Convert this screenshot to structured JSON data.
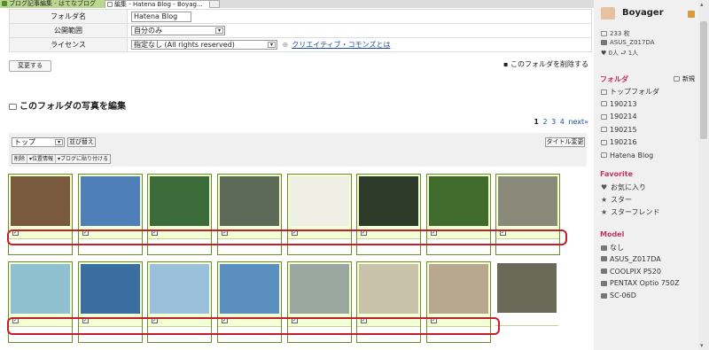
{
  "tabs": [
    {
      "label": "ブログ記事編集 - はてなブログ"
    },
    {
      "label": "編集 - Hatena Blog - Boyag...",
      "close": "×"
    }
  ],
  "form": {
    "rows": [
      {
        "label": "フォルダ名",
        "value": "Hatena Blog"
      },
      {
        "label": "公開範囲",
        "value": "自分のみ"
      },
      {
        "label": "ライセンス",
        "value": "指定なし (All rights reserved)",
        "link": "クリエイティブ・コモンズとは",
        "link_prefix": "⊕"
      }
    ],
    "change_button": "変更する",
    "delete_folder": "このフォルダを削除する"
  },
  "section": {
    "title": "このフォルダの写真を編集"
  },
  "pager": {
    "current": "1",
    "pages": [
      "2",
      "3",
      "4"
    ],
    "next": "next»"
  },
  "toolbar": {
    "sort_select": "トップ",
    "sort_button": "並び替え",
    "title_button": "タイトル変更",
    "actions": [
      "削除",
      "▾位置情報",
      "▾ブログに貼り付ける"
    ]
  },
  "photos": {
    "checkmark": "✓",
    "row1": [
      "#7a5a3c",
      "#4f7fb8",
      "#3c6b3a",
      "#5e6a58",
      "#efefe6",
      "#2f3b2a",
      "#3f6b2d",
      "#8a8a7a"
    ],
    "row2": [
      "#8fc0d0",
      "#3a6ea0",
      "#9bc0dc",
      "#5a8fc0",
      "#9aa7a0",
      "#c9c2aa",
      "#b8a890",
      "#6b6a58"
    ]
  },
  "sidebar": {
    "user": "Boyager",
    "stats": [
      "233 枚",
      "ASUS_Z017DA",
      "♥ 0人  ⮐ 1人"
    ],
    "folder_head": "フォルダ",
    "new_label": "新規",
    "folders": [
      "トップフォルダ",
      "190213",
      "190214",
      "190215",
      "190216",
      "Hatena Blog"
    ],
    "favorite_head": "Favorite",
    "favorites": [
      "お気に入り",
      "スター",
      "スターフレンド"
    ],
    "model_head": "Model",
    "models": [
      "なし",
      "ASUS_Z017DA",
      "COOLPIX P520",
      "PENTAX Optio 750Z",
      "SC-06D"
    ]
  },
  "colors": {
    "accent": "#c23264",
    "cell_bg": "#f3ffd4",
    "cell_border": "#6c8c2c",
    "highlight": "#c21f2a"
  }
}
